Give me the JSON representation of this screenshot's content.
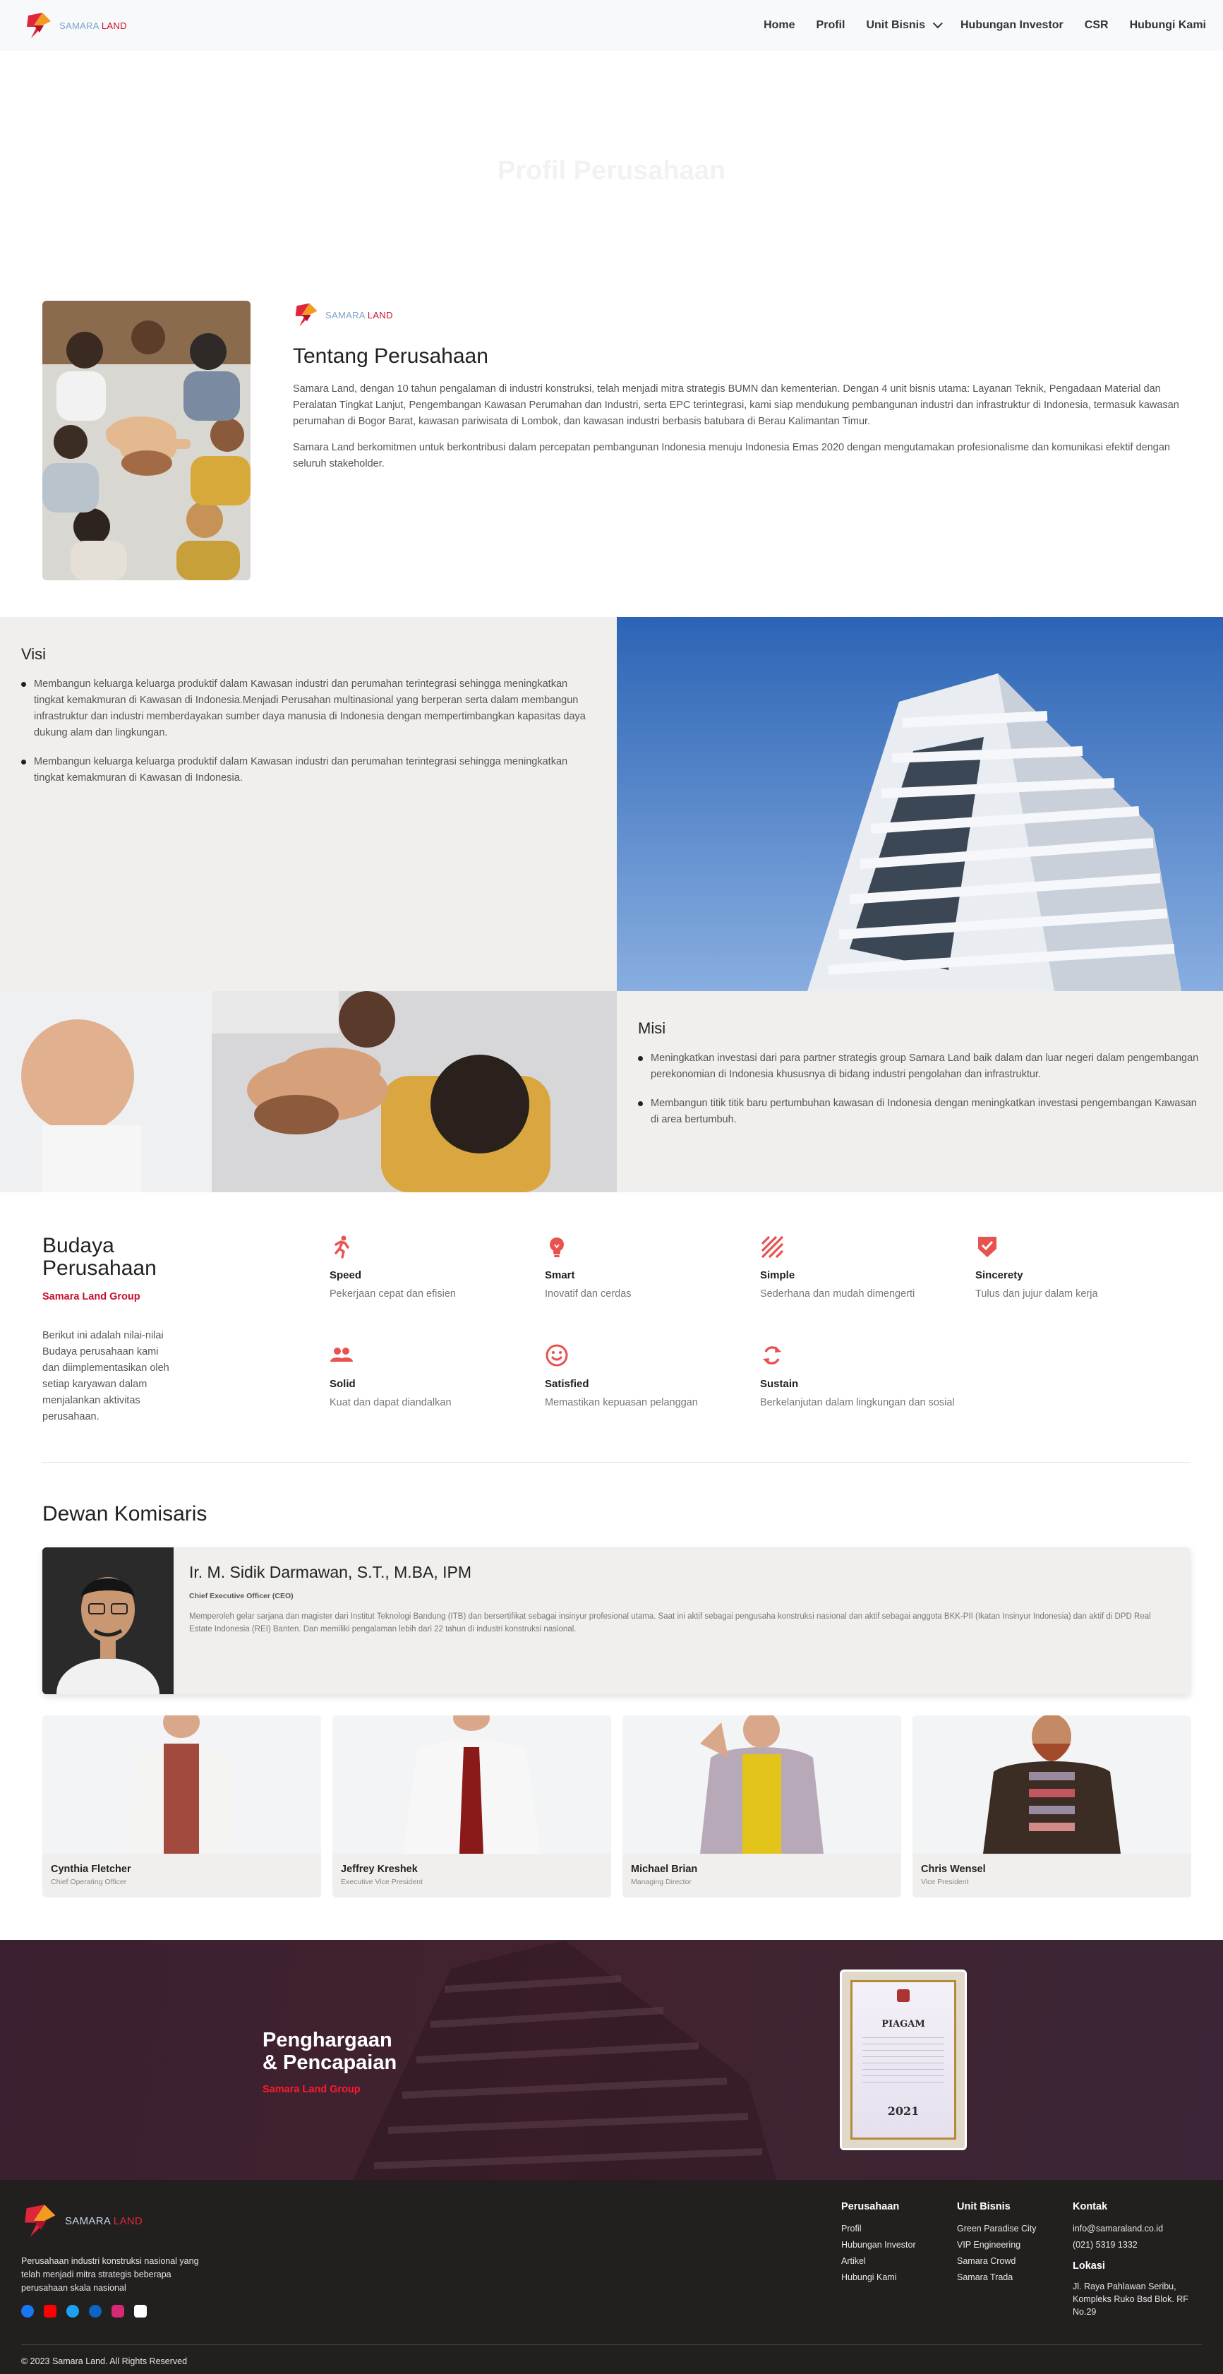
{
  "brand": {
    "name_a": "SAMARA",
    "name_b": "LAND"
  },
  "nav": {
    "items": [
      "Home",
      "Profil",
      "Unit Bisnis",
      "Hubungan Investor",
      "CSR",
      "Hubungi Kami"
    ]
  },
  "hero": {
    "title": "Profil Perusahaan"
  },
  "about": {
    "title": "Tentang Perusahaan",
    "p1": "Samara Land, dengan 10 tahun pengalaman di industri konstruksi, telah menjadi mitra strategis BUMN dan kementerian. Dengan 4 unit bisnis utama: Layanan Teknik, Pengadaan Material dan Peralatan Tingkat Lanjut, Pengembangan Kawasan Perumahan dan Industri, serta EPC terintegrasi, kami siap mendukung pembangunan industri dan infrastruktur di Indonesia, termasuk kawasan perumahan di Bogor Barat, kawasan pariwisata di Lombok, dan kawasan industri berbasis batubara di Berau Kalimantan Timur.",
    "p2": "Samara Land berkomitmen untuk berkontribusi dalam percepatan pembangunan Indonesia menuju Indonesia Emas 2020 dengan mengutamakan profesionalisme dan komunikasi efektif dengan seluruh stakeholder."
  },
  "visi": {
    "title": "Visi",
    "items": [
      "Membangun keluarga keluarga produktif dalam Kawasan industri dan perumahan terintegrasi sehingga meningkatkan tingkat kemakmuran di Kawasan di Indonesia.Menjadi Perusahan multinasional yang berperan serta dalam membangun infrastruktur dan industri memberdayakan sumber daya manusia di Indonesia dengan mempertimbangkan kapasitas daya dukung alam dan lingkungan.",
      "Membangun keluarga keluarga produktif dalam Kawasan industri dan perumahan terintegrasi sehingga meningkatkan tingkat kemakmuran di Kawasan di Indonesia."
    ]
  },
  "misi": {
    "title": "Misi",
    "items": [
      "Meningkatkan investasi dari para partner strategis group Samara Land baik dalam dan luar negeri dalam pengembangan perekonomian di Indonesia khususnya di bidang industri pengolahan dan infrastruktur.",
      "Membangun titik titik baru pertumbuhan kawasan di Indonesia dengan meningkatkan investasi pengembangan Kawasan di area bertumbuh."
    ]
  },
  "budaya": {
    "title_1": "Budaya",
    "title_2": "Perusahaan",
    "subtitle": "Samara Land Group",
    "desc": "Berikut ini adalah nilai-nilai Budaya perusahaan kami dan diimplementasikan oleh setiap karyawan dalam menjalankan aktivitas perusahaan.",
    "values": [
      {
        "icon": "running-icon",
        "title": "Speed",
        "desc": "Pekerjaan cepat dan efisien"
      },
      {
        "icon": "lightbulb-icon",
        "title": "Smart",
        "desc": "Inovatif dan cerdas"
      },
      {
        "icon": "stripes-icon",
        "title": "Simple",
        "desc": "Sederhana dan mudah dimengerti"
      },
      {
        "icon": "shield-check-icon",
        "title": "Sincerety",
        "desc": "Tulus dan jujur dalam kerja"
      },
      {
        "icon": "group-icon",
        "title": "Solid",
        "desc": "Kuat dan dapat diandalkan"
      },
      {
        "icon": "smile-icon",
        "title": "Satisfied",
        "desc": "Memastikan kepuasan pelanggan"
      },
      {
        "icon": "refresh-icon",
        "title": "Sustain",
        "desc": "Berkelanjutan dalam lingkungan dan sosial"
      }
    ],
    "accent": "#e8524f"
  },
  "dewan": {
    "title": "Dewan Komisaris",
    "ceo": {
      "name": "Ir. M. Sidik Darmawan, S.T., M.BA, IPM",
      "role": "Chief Executive Officer (CEO)",
      "desc": "Memperoleh gelar sarjana dan magister dari Institut Teknologi Bandung (ITB) dan bersertifikat sebagai insinyur profesional utama. Saat ini aktif sebagai pengusaha konstruksi nasional dan aktif sebagai anggota BKK-PII (Ikatan Insinyur Indonesia) dan aktif di DPD Real Estate Indonesia (REI) Banten. Dan memiliki pengalaman lebih dari 22 tahun di industri konstruksi nasional."
    },
    "team": [
      {
        "name": "Cynthia Fletcher",
        "role": "Chief Operating Officer"
      },
      {
        "name": "Jeffrey Kreshek",
        "role": "Executive Vice President"
      },
      {
        "name": "Michael Brian",
        "role": "Managing Director"
      },
      {
        "name": "Chris Wensel",
        "role": "Vice President"
      }
    ]
  },
  "award": {
    "title_1": "Penghargaan",
    "title_2": "& Pencapaian",
    "subtitle": "Samara Land Group",
    "doc_title": "PIAGAM",
    "doc_year": "2021"
  },
  "footer": {
    "desc": "Perusahaan industri konstruksi nasional yang telah menjadi mitra strategis beberapa perusahaan skala nasional",
    "cols": [
      {
        "title": "Perusahaan",
        "items": [
          "Profil",
          "Hubungan Investor",
          "Artikel",
          "Hubungi Kami"
        ]
      },
      {
        "title": "Unit Bisnis",
        "items": [
          "Green Paradise City",
          "VIP Engineering",
          "Samara Crowd",
          "Samara Trada"
        ]
      }
    ],
    "kontak": {
      "title": "Kontak",
      "email": "info@samaraland.co.id",
      "phone": "(021) 5319 1332",
      "lokasi_title": "Lokasi",
      "alamat": "Jl. Raya Pahlawan Seribu, Kompleks Ruko Bsd Blok. RF No.29"
    },
    "copyright": "© 2023 Samara Land. All Rights Reserved"
  }
}
